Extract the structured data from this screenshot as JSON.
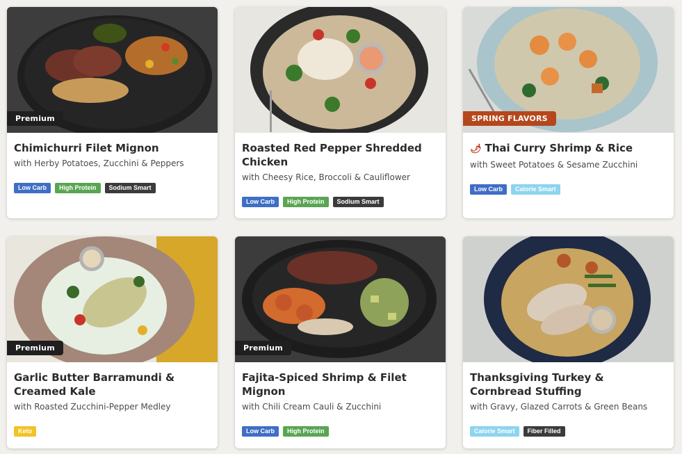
{
  "colors": {
    "low_carb": "#3f6ec6",
    "high_protein": "#5aa553",
    "sodium_smart": "#3b3b3b",
    "calorie_smart": "#8dd4ef",
    "keto": "#f2c326",
    "fiber_filled": "#3b3b3b",
    "premium_badge": "#1f1f1f",
    "spring_badge": "#b5471c"
  },
  "meals": [
    {
      "badge": "Premium",
      "title": "Chimichurri Filet Mignon",
      "subtitle": "with Herby Potatoes, Zucchini & Peppers",
      "tags": [
        "Low Carb",
        "High Protein",
        "Sodium Smart"
      ]
    },
    {
      "badge": "",
      "title": "Roasted Red Pepper Shredded Chicken",
      "subtitle": "with Cheesy Rice, Broccoli & Cauliflower",
      "tags": [
        "Low Carb",
        "High Protein",
        "Sodium Smart"
      ]
    },
    {
      "badge": "SPRING FLAVORS",
      "title": "Thai Curry Shrimp & Rice",
      "subtitle": "with Sweet Potatoes & Sesame Zucchini",
      "tags": [
        "Low Carb",
        "Calorie Smart"
      ]
    },
    {
      "badge": "Premium",
      "title": "Garlic Butter Barramundi & Creamed Kale",
      "subtitle": "with Roasted Zucchini-Pepper Medley",
      "tags": [
        "Keto"
      ]
    },
    {
      "badge": "Premium",
      "title": "Fajita-Spiced Shrimp & Filet Mignon",
      "subtitle": "with Chili Cream Cauli & Zucchini",
      "tags": [
        "Low Carb",
        "High Protein"
      ]
    },
    {
      "badge": "",
      "title": "Thanksgiving Turkey & Cornbread Stuffing",
      "subtitle": "with Gravy, Glazed Carrots & Green Beans",
      "tags": [
        "Calorie Smart",
        "Fiber Filled"
      ]
    }
  ]
}
